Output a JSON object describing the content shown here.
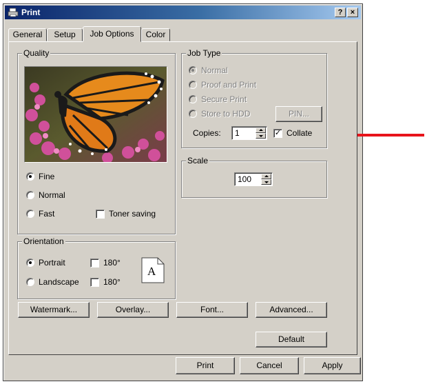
{
  "window": {
    "title": "Print",
    "help_label": "?",
    "close_label": "×"
  },
  "tabs": [
    {
      "label": "General"
    },
    {
      "label": "Setup"
    },
    {
      "label": "Job Options",
      "active": true
    },
    {
      "label": "Color"
    }
  ],
  "quality": {
    "legend": "Quality",
    "image": "monarch butterfly on pink flowers",
    "options": [
      {
        "label": "Fine",
        "selected": true
      },
      {
        "label": "Normal",
        "selected": false
      },
      {
        "label": "Fast",
        "selected": false
      }
    ],
    "toner_saving": {
      "label": "Toner saving",
      "checked": false
    }
  },
  "orientation": {
    "legend": "Orientation",
    "portrait": {
      "label": "Portrait",
      "selected": true
    },
    "landscape": {
      "label": "Landscape",
      "selected": false
    },
    "rotate_portrait": {
      "label": "180°",
      "checked": false
    },
    "rotate_landscape": {
      "label": "180°",
      "checked": false
    },
    "icon_letter": "A"
  },
  "job_type": {
    "legend": "Job Type",
    "options": [
      {
        "label": "Normal",
        "selected": true
      },
      {
        "label": "Proof and Print",
        "selected": false
      },
      {
        "label": "Secure Print",
        "selected": false
      },
      {
        "label": "Store to HDD",
        "selected": false
      }
    ],
    "pin_label": "PIN...",
    "copies_label": "Copies:",
    "copies_value": "1",
    "collate": {
      "label": "Collate",
      "checked": true
    }
  },
  "scale": {
    "legend": "Scale",
    "value": "100"
  },
  "buttons": {
    "watermark": "Watermark...",
    "overlay": "Overlay...",
    "font": "Font...",
    "advanced": "Advanced...",
    "default": "Default",
    "print": "Print",
    "cancel": "Cancel",
    "apply": "Apply"
  },
  "annotation": {
    "arrow_color": "#e8141b"
  },
  "colors": {
    "dialog_bg": "#d4d0c8",
    "title_start": "#0a246a",
    "title_end": "#a6caf0"
  }
}
